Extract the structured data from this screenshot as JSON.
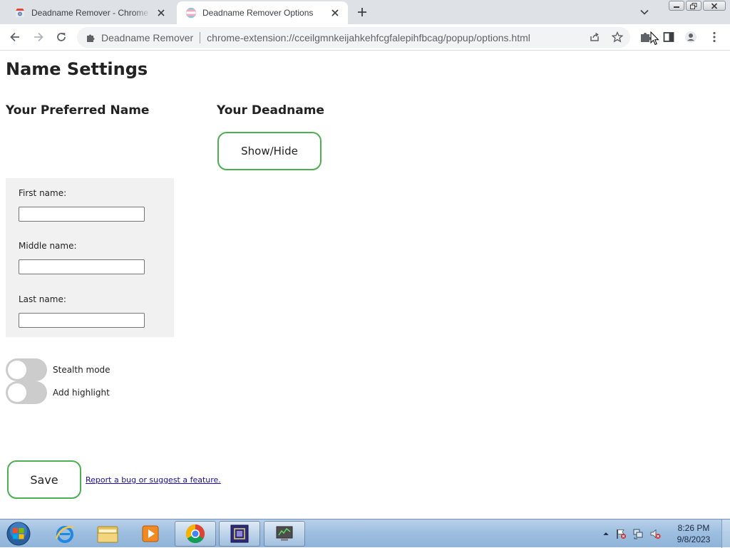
{
  "browser": {
    "tabs": [
      {
        "title": "Deadname Remover - Chrome Web Store",
        "active": false
      },
      {
        "title": "Deadname Remover Options",
        "active": true
      }
    ],
    "omnibox": {
      "site_name": "Deadname Remover",
      "url": "chrome-extension://cceilgmnkeijahkehfcgfalepihfbcag/popup/options.html"
    }
  },
  "page": {
    "title": "Name Settings",
    "preferred_heading": "Your Preferred Name",
    "deadname_heading": "Your Deadname",
    "show_hide_label": "Show/Hide",
    "fields": {
      "first_label": "First name:",
      "first_value": "",
      "middle_label": "Middle name:",
      "middle_value": "",
      "last_label": "Last name:",
      "last_value": ""
    },
    "toggles": [
      {
        "label": "Stealth mode",
        "checked": false
      },
      {
        "label": "Add highlight",
        "checked": false
      }
    ],
    "save_label": "Save",
    "report_link": "Report a bug or suggest a feature.",
    "accent_color": "#4caf50"
  },
  "taskbar": {
    "apps": [
      "internet-explorer",
      "windows-explorer",
      "media-player",
      "google-chrome",
      "app-window",
      "network-tool"
    ],
    "clock_time": "8:26 PM",
    "clock_date": "9/8/2023"
  }
}
